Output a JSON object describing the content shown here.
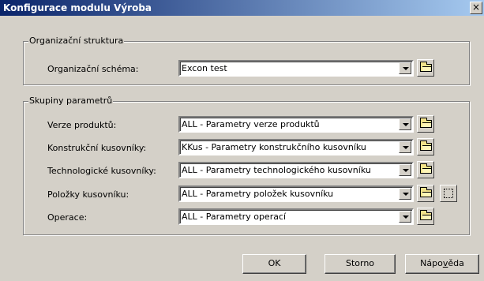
{
  "window": {
    "title": "Konfigurace modulu Výroba",
    "close_glyph": "×"
  },
  "org_group": {
    "legend": "Organizační struktura",
    "schema_label": "Organizační schéma:",
    "schema_value": "Excon test"
  },
  "param_group": {
    "legend": "Skupiny parametrů",
    "rows": [
      {
        "label": "Verze produktů:",
        "value": "ALL - Parametry verze produktů"
      },
      {
        "label": "Konstrukční kusovníky:",
        "value": "KKus - Parametry konstrukčního kusovníku"
      },
      {
        "label": "Technologické kusovníky:",
        "value": "ALL - Parametry technologického kusovníku"
      },
      {
        "label": "Položky kusovníku:",
        "value": "ALL - Parametry položek kusovníku"
      },
      {
        "label": "Operace:",
        "value": "ALL - Parametry operací"
      }
    ]
  },
  "buttons": {
    "ok": "OK",
    "cancel": "Storno",
    "help_prefix": "Nápo",
    "help_mnemonic": "v",
    "help_suffix": "ěda"
  },
  "icons": {
    "browse": "folder-icon",
    "details": "ellipsis-icon",
    "dropdown": "chevron-down-icon"
  }
}
